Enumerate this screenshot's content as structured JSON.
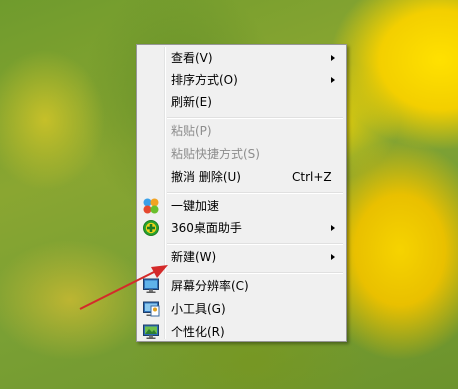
{
  "menu": {
    "view": "查看(V)",
    "sort_by": "排序方式(O)",
    "refresh": "刷新(E)",
    "paste": "粘贴(P)",
    "paste_shortcut": "粘贴快捷方式(S)",
    "undo_delete": "撤消 删除(U)",
    "undo_shortcut": "Ctrl+Z",
    "speed_up": "一键加速",
    "desktop_helper": "360桌面助手",
    "new": "新建(W)",
    "screen_resolution": "屏幕分辨率(C)",
    "gadgets": "小工具(G)",
    "personalize": "个性化(R)"
  },
  "annotation": {
    "color": "#d42a2a"
  }
}
